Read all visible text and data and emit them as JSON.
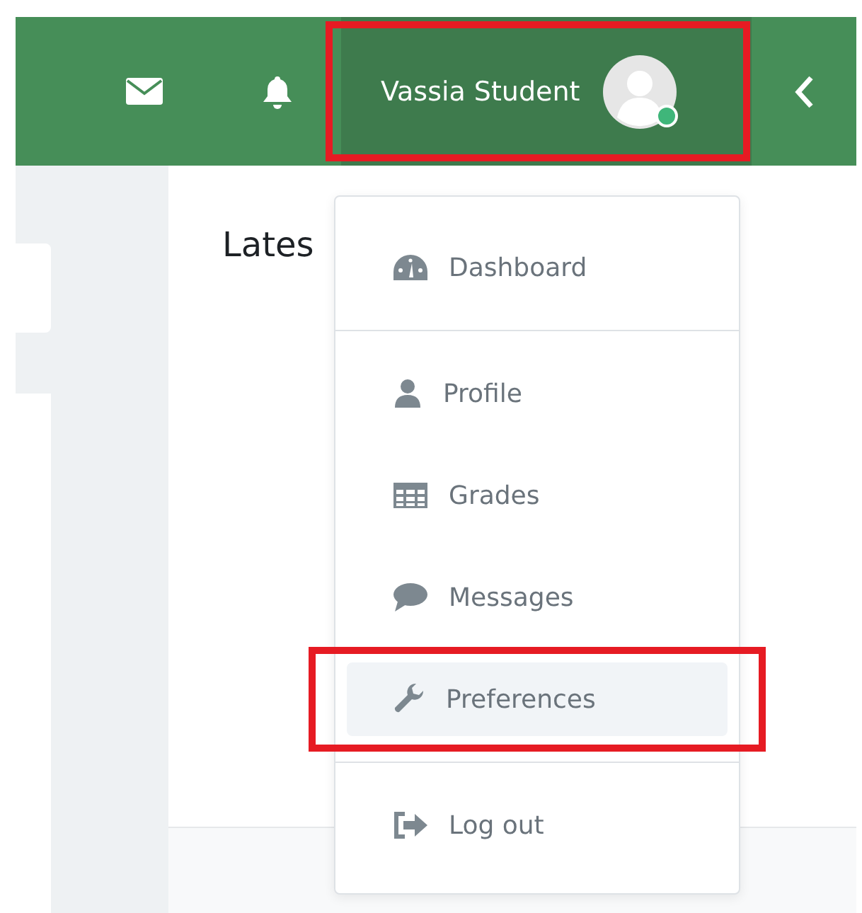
{
  "navbar": {
    "user_name": "Vassia Student",
    "online": true,
    "highlighted": true
  },
  "content": {
    "heading": "Lates"
  },
  "user_menu": {
    "items": [
      {
        "kind": "dashboard",
        "label": "Dashboard",
        "selected": false,
        "highlighted": false
      },
      {
        "kind": "divider"
      },
      {
        "kind": "profile",
        "label": "Profile",
        "selected": false,
        "highlighted": false
      },
      {
        "kind": "grades",
        "label": "Grades",
        "selected": false,
        "highlighted": false
      },
      {
        "kind": "messages",
        "label": "Messages",
        "selected": false,
        "highlighted": false
      },
      {
        "kind": "preferences",
        "label": "Preferences",
        "selected": true,
        "highlighted": true
      },
      {
        "kind": "divider"
      },
      {
        "kind": "logout",
        "label": "Log out",
        "selected": false,
        "highlighted": false
      }
    ]
  }
}
